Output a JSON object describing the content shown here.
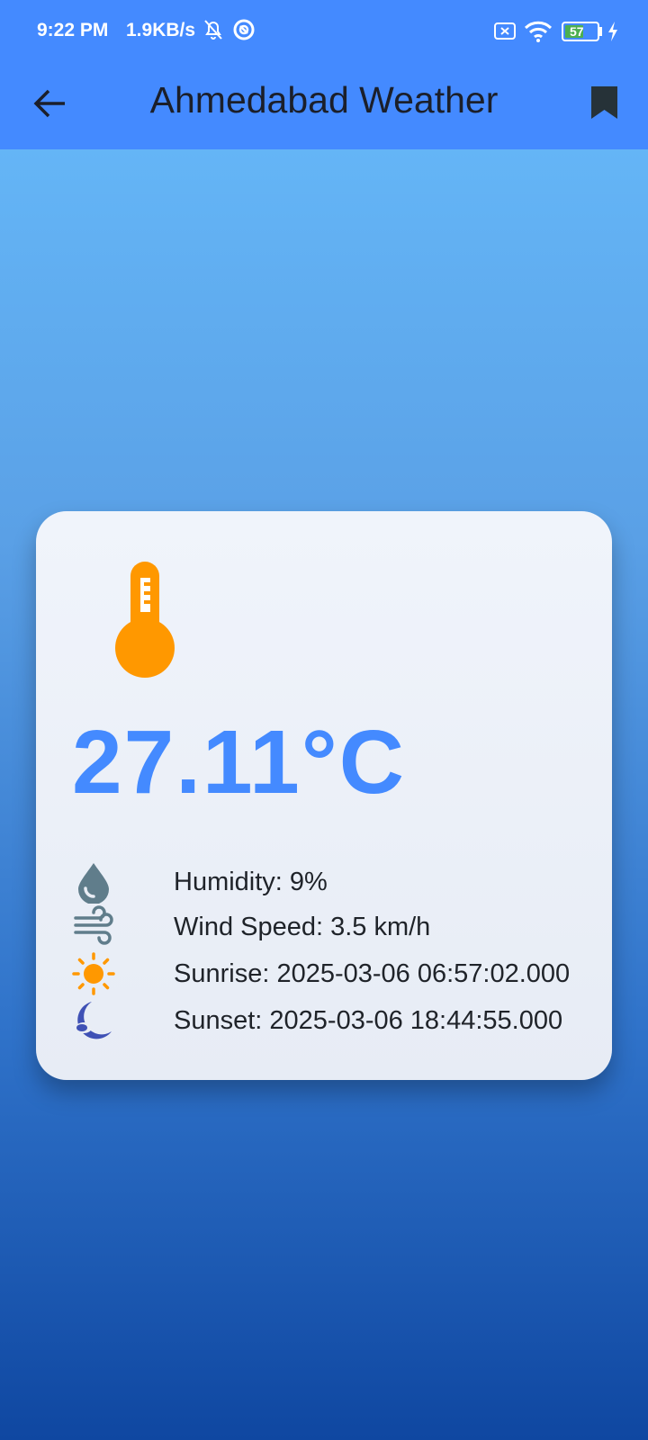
{
  "status_bar": {
    "time": "9:22 PM",
    "net_speed": "1.9KB/s",
    "battery": "57"
  },
  "app_bar": {
    "title": "Ahmedabad Weather",
    "back_icon": "arrow-left-icon",
    "bookmark_icon": "bookmark-icon"
  },
  "weather": {
    "temperature": "27.11°C",
    "humidity": "Humidity: 9%",
    "wind_speed": "Wind Speed: 3.5 km/h",
    "sunrise": "Sunrise: 2025-03-06 06:57:02.000",
    "sunset": "Sunset: 2025-03-06 18:44:55.000"
  },
  "colors": {
    "app_bar": "#448aff",
    "temperature_text": "#448aff",
    "thermometer": "#ff9800",
    "humidity_icon": "#607d8b",
    "wind_icon": "#607d8b",
    "sun_icon": "#ff9800",
    "moon_icon": "#3f51b5"
  }
}
